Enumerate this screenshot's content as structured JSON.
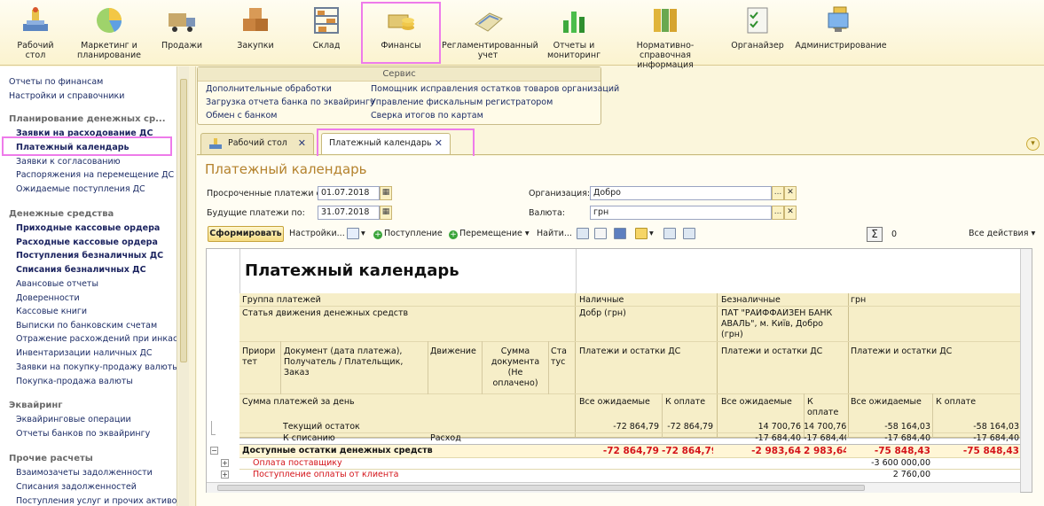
{
  "toolbar": {
    "items": [
      {
        "label": "Рабочий стол",
        "icon": "desktop-icon"
      },
      {
        "label": "Маркетинг и планирование",
        "icon": "pie-chart-icon"
      },
      {
        "label": "Продажи",
        "icon": "truck-icon"
      },
      {
        "label": "Закупки",
        "icon": "boxes-icon"
      },
      {
        "label": "Склад",
        "icon": "shelves-icon"
      },
      {
        "label": "Финансы",
        "icon": "coins-icon"
      },
      {
        "label": "Регламентированный учет",
        "icon": "ledger-icon"
      },
      {
        "label": "Отчеты и мониторинг",
        "icon": "bar-chart-icon"
      },
      {
        "label": "Нормативно-справочная информация",
        "icon": "binders-icon"
      },
      {
        "label": "Органайзер",
        "icon": "checklist-icon"
      },
      {
        "label": "Администрирование",
        "icon": "computer-icon"
      }
    ],
    "active_index": 5
  },
  "left_panel": {
    "top_links": [
      "Отчеты по финансам",
      "Настройки и справочники"
    ],
    "sections": [
      {
        "title": "Планирование денежных ср...",
        "items": [
          {
            "label": "Заявки на расходование ДС",
            "bold": true
          },
          {
            "label": "Платежный календарь",
            "bold": true
          },
          {
            "label": "Заявки к согласованию",
            "bold": false
          },
          {
            "label": "Распоряжения на перемещение ДС",
            "bold": false
          },
          {
            "label": "Ожидаемые поступления ДС",
            "bold": false
          }
        ]
      },
      {
        "title": "Денежные средства",
        "items": [
          {
            "label": "Приходные кассовые ордера",
            "bold": true
          },
          {
            "label": "Расходные кассовые ордера",
            "bold": true
          },
          {
            "label": "Поступления безналичных ДС",
            "bold": true
          },
          {
            "label": "Списания безналичных ДС",
            "bold": true
          },
          {
            "label": "Авансовые отчеты",
            "bold": false
          },
          {
            "label": "Доверенности",
            "bold": false
          },
          {
            "label": "Кассовые книги",
            "bold": false
          },
          {
            "label": "Выписки по банковским счетам",
            "bold": false
          },
          {
            "label": "Отражение расхождений при инкас...",
            "bold": false
          },
          {
            "label": "Инвентаризации наличных ДС",
            "bold": false
          },
          {
            "label": "Заявки на покупку-продажу валюты",
            "bold": false
          },
          {
            "label": "Покупка-продажа валюты",
            "bold": false
          }
        ]
      },
      {
        "title": "Эквайринг",
        "items": [
          {
            "label": "Эквайринговые операции",
            "bold": false
          },
          {
            "label": "Отчеты банков по эквайрингу",
            "bold": false
          }
        ]
      },
      {
        "title": "Прочие расчеты",
        "items": [
          {
            "label": "Взаимозачеты задолженности",
            "bold": false
          },
          {
            "label": "Списания задолженностей",
            "bold": false
          },
          {
            "label": "Поступления услуг и прочих активов",
            "bold": false
          }
        ]
      }
    ]
  },
  "service": {
    "caption": "Сервис",
    "col1": [
      "Дополнительные обработки",
      "Загрузка отчета банка по эквайрингу",
      "Обмен с банком"
    ],
    "col2": [
      "Помощник исправления остатков товаров организаций",
      "Управление фискальным регистратором",
      "Сверка итогов по картам"
    ]
  },
  "tabs": [
    {
      "label": "Рабочий стол",
      "close": "✕"
    },
    {
      "label": "Платежный календарь",
      "close": "✕"
    }
  ],
  "form": {
    "title": "Платежный календарь",
    "overdue_label": "Просроченные платежи с:",
    "overdue_value": "01.07.2018",
    "future_label": "Будущие платежи по:",
    "future_value": "31.07.2018",
    "org_label": "Организация:",
    "org_value": "Добро",
    "currency_label": "Валюта:",
    "currency_value": "грн",
    "select_btn": "...",
    "clear_btn": "✕"
  },
  "commands": {
    "generate": "Сформировать",
    "settings": "Настройки...",
    "receipt": "Поступление",
    "transfer": "Перемещение",
    "find": "Найти...",
    "sum_symbol": "Σ",
    "sum_value": "0",
    "all_actions": "Все действия"
  },
  "report": {
    "title": "Платежный календарь",
    "group_header": "Группа платежей",
    "article_header": "Статья движения денежных средств",
    "col_priority": "Приори тет",
    "col_document": "Документ (дата платежа), Получатель / Плательщик, Заказ",
    "col_movement": "Движение",
    "col_amount": "Сумма документа (Не оплачено)",
    "col_status": "Ста тус",
    "daily_sum": "Сумма платежей за день",
    "groups": [
      {
        "name": "Наличные",
        "sub": "Добр (грн)",
        "caption": "Платежи и остатки ДС",
        "expected": "Все ожидаемые",
        "to_pay": "К оплате"
      },
      {
        "name": "Безналичные",
        "sub": "ПАТ \"РАЙФФАЙЗЕН БАНК АВАЛЬ\", м. Київ, Добро (грн)",
        "caption": "Платежи и остатки ДС",
        "expected": "Все ожидаемые",
        "to_pay": "К оплате"
      },
      {
        "name": "грн",
        "sub": "",
        "caption": "Платежи и остатки ДС",
        "expected": "Все ожидаемые",
        "to_pay": "К оплате"
      }
    ],
    "rows": [
      {
        "label": "Текущий остаток",
        "movement": "",
        "v": [
          "-72 864,79",
          "-72 864,79",
          "14 700,76",
          "14 700,76",
          "-58 164,03",
          "-58 164,03"
        ],
        "style": "normal"
      },
      {
        "label": "К списанию",
        "movement": "Расход",
        "v": [
          "",
          "",
          "-17 684,40",
          "-17 684,40",
          "-17 684,40",
          "-17 684,40"
        ],
        "style": "normal"
      },
      {
        "label": "Доступные остатки денежных средств",
        "movement": "",
        "v": [
          "-72 864,79",
          "-72 864,79",
          "-2 983,64",
          "2 983,64",
          "-75 848,43",
          "-75 848,43"
        ],
        "style": "total"
      },
      {
        "label": "Оплата поставщику",
        "movement": "",
        "v": [
          "",
          "",
          "",
          "",
          "-3 600 000,00",
          ""
        ],
        "style": "red"
      },
      {
        "label": "Поступление оплаты от клиента",
        "movement": "",
        "v": [
          "",
          "",
          "",
          "",
          "2 760,00",
          ""
        ],
        "style": "red"
      }
    ]
  },
  "colors": {
    "highlight": "#ee7bea",
    "title": "#b4822d",
    "negative": "#d4141a",
    "header_bg": "#f6eec8"
  }
}
